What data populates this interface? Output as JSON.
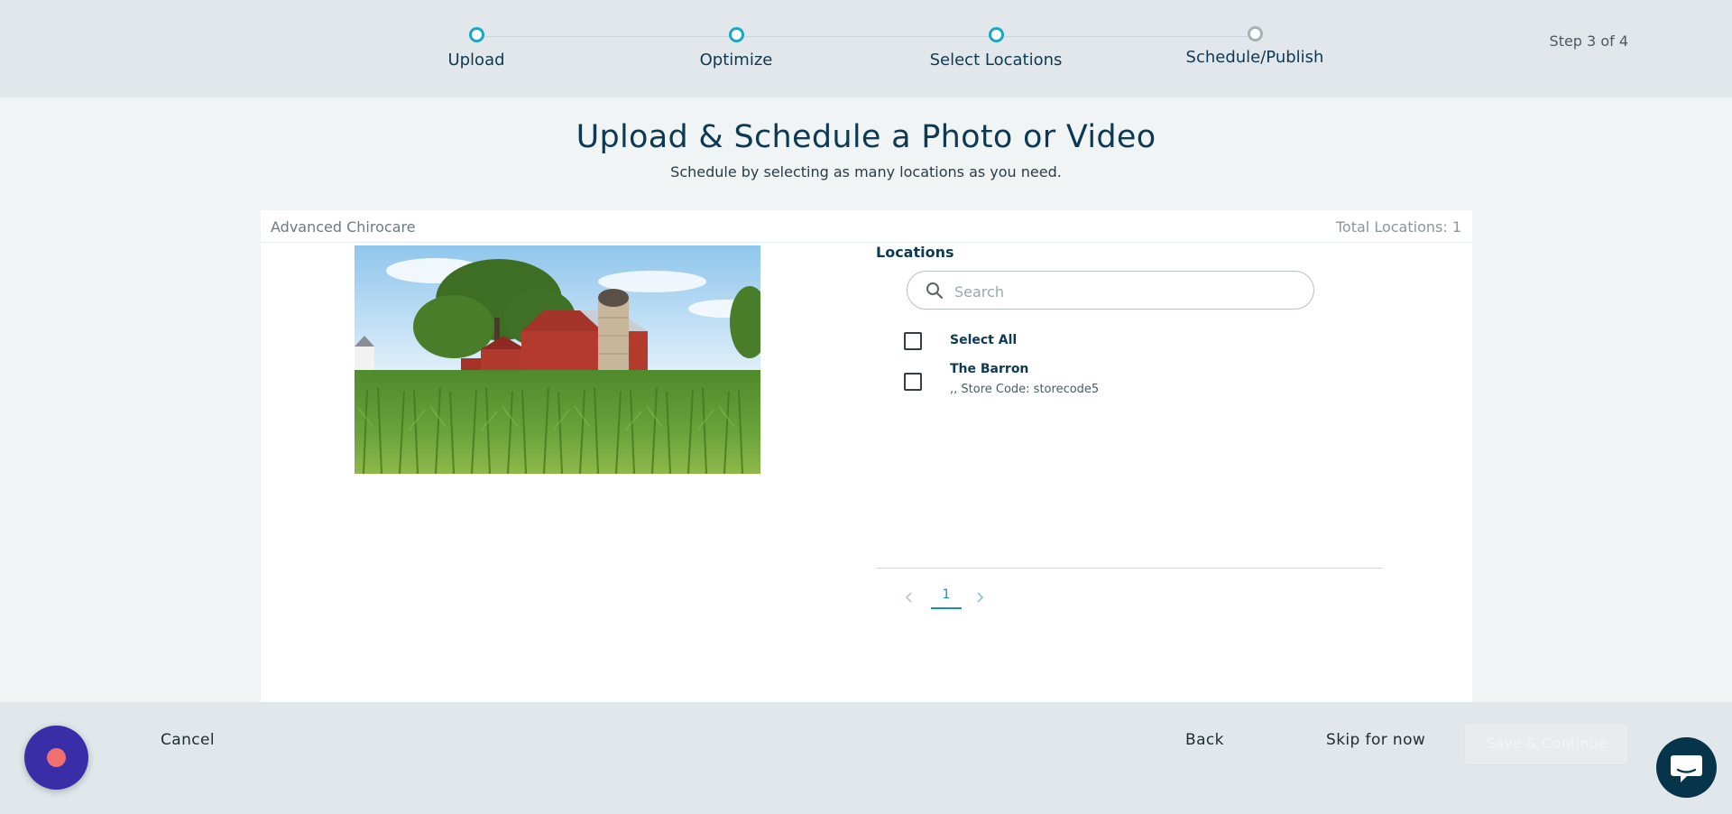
{
  "stepper": {
    "steps": [
      {
        "label": "Upload",
        "state": "complete"
      },
      {
        "label": "Optimize",
        "state": "complete"
      },
      {
        "label": "Select Locations",
        "state": "current"
      },
      {
        "label": "Schedule/Publish",
        "state": "pending"
      }
    ],
    "step_count": "Step 3 of 4"
  },
  "header": {
    "title": "Upload & Schedule a Photo or Video",
    "subtitle": "Schedule by selecting as many locations as you need."
  },
  "card": {
    "account_name": "Advanced Chirocare",
    "total_locations": "Total Locations: 1"
  },
  "locations": {
    "title": "Locations",
    "search": {
      "placeholder": "Search",
      "value": ""
    },
    "select_all_label": "Select All",
    "items": [
      {
        "name": "The Barron",
        "detail": ",, Store Code: storecode5",
        "checked": false
      }
    ],
    "pagination": {
      "current_page": "1"
    }
  },
  "footer": {
    "cancel_label": "Cancel",
    "back_label": "Back",
    "skip_label": "Skip for now",
    "save_label": "Save & Continue"
  },
  "colors": {
    "accent": "#1aa7c4",
    "primary_text": "#0d3a52",
    "chrome_bg": "#e1e7ea",
    "record_button": "#3a2ea8",
    "chat_button": "#06344a"
  },
  "icons": {
    "search": "search-icon",
    "prev": "chevron-left-icon",
    "next": "chevron-right-icon",
    "record": "record-icon",
    "chat": "chat-bubble-icon"
  }
}
